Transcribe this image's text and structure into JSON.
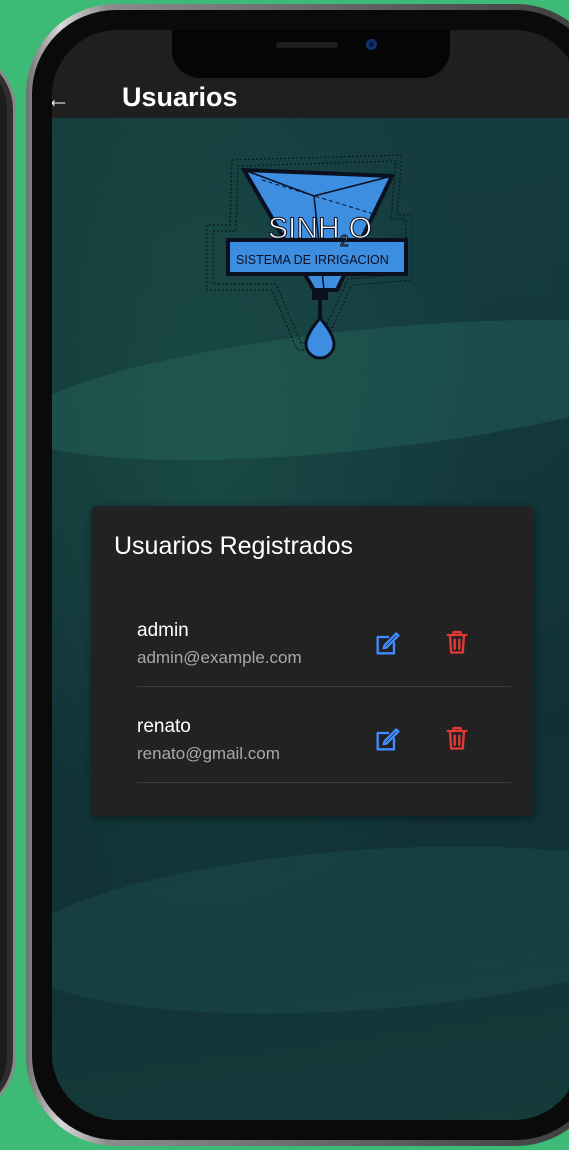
{
  "appbar": {
    "back_icon": "back-arrow-icon",
    "title": "Usuarios"
  },
  "logo": {
    "line1": "SINH",
    "line1_sub": "2",
    "line1_end": "O",
    "line2": "SISTEMA DE IRRIGACION"
  },
  "card": {
    "title": "Usuarios Registrados",
    "users": [
      {
        "name": "admin",
        "email": "admin@example.com"
      },
      {
        "name": "renato",
        "email": "renato@gmail.com"
      }
    ]
  },
  "colors": {
    "background_green": "#3dbb76",
    "appbar": "#1f1f1f",
    "card": "#222222",
    "edit_icon": "#3f8cff",
    "delete_icon": "#e53935",
    "logo_blue": "#3d8de0"
  }
}
